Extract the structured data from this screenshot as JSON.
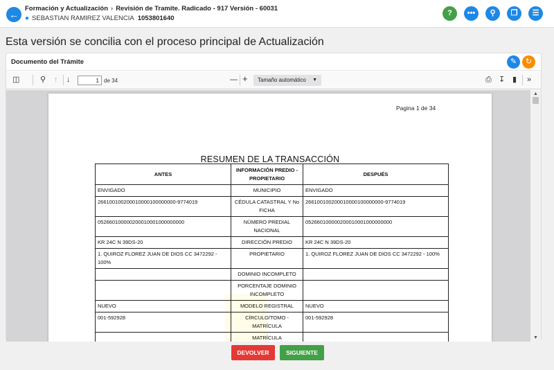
{
  "header": {
    "breadcrumb": [
      "Formación y Actualización",
      "Revisión de Tramite. Radicado - 917 Versión - 60031"
    ],
    "user_name": "SEBASTIAN RAMIREZ VALENCIA",
    "user_id": "1053801640",
    "icons": [
      "help-icon",
      "more-icon",
      "attachment-icon",
      "copy-icon",
      "notes-icon"
    ]
  },
  "main_title": "Esta versión se concilia con el proceso principal de Actualización",
  "panel": {
    "title": "Documento del Trámite"
  },
  "pdf_toolbar": {
    "current_page": "1",
    "page_of": "de 34",
    "zoom": "Tamaño automático"
  },
  "document": {
    "page_label": "Pagina 1 de 34",
    "title": "RESUMEN DE LA TRANSACCIÓN",
    "columns": [
      "ANTES",
      "INFORMACIÓN PREDIO - PROPIETARIO",
      "DESPUÉS"
    ],
    "rows": [
      [
        "ENVIGADO",
        "MUNICIPIO",
        "ENVIGADO"
      ],
      [
        "266100100200010000100000000-9774019",
        "CÉDULA CATASTRAL Y No FICHA",
        "266100100200010000100000000-9774019"
      ],
      [
        "052660100000200010001000000000",
        "NÚMERO PREDIAL NACIONAL",
        "052660100000200010001000000000"
      ],
      [
        "KR 24C N 39DS-20",
        "DIRECCIÓN PREDIO",
        "KR 24C N 39DS-20"
      ],
      [
        "1. QUIROZ FLOREZ JUAN DE DIOS CC 3472292 - 100%",
        "PROPIETARIO",
        "1. QUIROZ FLOREZ JUAN DE DIOS CC 3472292 - 100%"
      ],
      [
        "",
        "DOMINIO INCOMPLETO",
        ""
      ],
      [
        "",
        "PORCENTAJE DOMINIO INCOMPLETO",
        ""
      ],
      [
        "NUEVO",
        "MODELO REGISTRAL",
        "NUEVO"
      ],
      [
        "001-592928",
        "CÍRCULO/TOMO - MATRÍCULA",
        "001-592928"
      ],
      [
        "",
        "MATRÍCULA",
        ""
      ]
    ]
  },
  "buttons": {
    "devolver": "DEVOLVER",
    "siguiente": "SIGUIENTE"
  }
}
